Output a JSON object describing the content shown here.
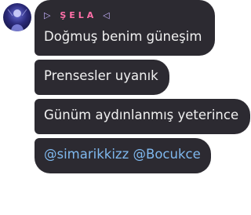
{
  "sender": {
    "left_mark": "▷",
    "name": "ŞELA",
    "right_mark": "◁"
  },
  "messages": [
    {
      "text": "Doğmuş benim güneşim"
    },
    {
      "text": "Prensesler uyanık"
    },
    {
      "text": "Günüm aydınlanmış yeterince"
    }
  ],
  "mentions": [
    "@simarikkizz",
    "@Bocukce"
  ],
  "colors": {
    "bubble": "#2c2a31",
    "text": "#f1f1f1",
    "sender_name": "#ff6fa8",
    "sender_mark": "#c7b3ff",
    "mention": "#7fb8ee"
  }
}
